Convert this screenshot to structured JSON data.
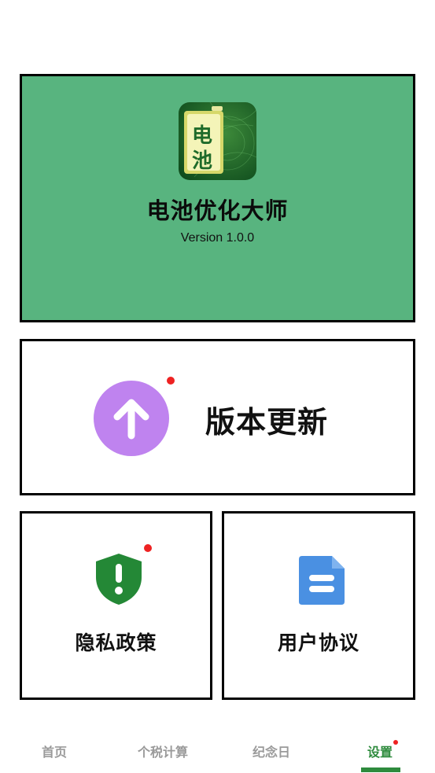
{
  "colors": {
    "app_card_bg": "#58b47f",
    "accent_green": "#2e8b3d",
    "update_purple": "#bf83ef",
    "shield_green": "#248836",
    "doc_blue": "#4a90e2",
    "badge_red": "#ee2222",
    "nav_inactive": "#9a9a9a"
  },
  "app_info": {
    "icon": "battery-app-icon",
    "icon_text_top": "电",
    "icon_text_bottom": "池",
    "name": "电池优化大师",
    "version": "Version 1.0.0"
  },
  "update": {
    "icon": "arrow-up-icon",
    "label": "版本更新",
    "has_badge": true
  },
  "privacy": {
    "icon": "shield-alert-icon",
    "label": "隐私政策",
    "has_badge": true
  },
  "agreement": {
    "icon": "document-icon",
    "label": "用户协议"
  },
  "nav": {
    "items": [
      {
        "label": "首页"
      },
      {
        "label": "个税计算"
      },
      {
        "label": "纪念日"
      },
      {
        "label": "设置"
      }
    ],
    "active_index": 3
  }
}
